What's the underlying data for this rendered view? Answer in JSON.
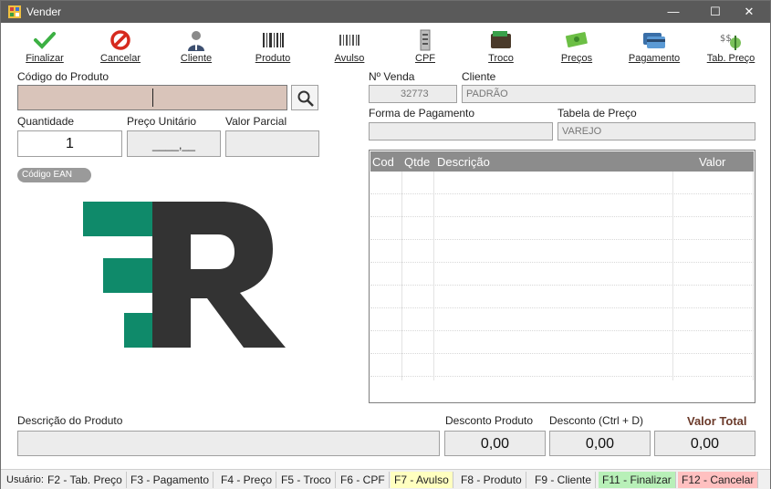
{
  "window": {
    "title": "Vender",
    "minimize": "—",
    "maximize": "☐",
    "close": "✕"
  },
  "toolbar": [
    {
      "label": "Finalizar",
      "icon": "check-icon"
    },
    {
      "label": "Cancelar",
      "icon": "cancel-icon"
    },
    {
      "label": "Cliente",
      "icon": "user-icon"
    },
    {
      "label": "Produto",
      "icon": "barcode-icon"
    },
    {
      "label": "Avulso",
      "icon": "barcode-alt-icon"
    },
    {
      "label": "CPF",
      "icon": "document-icon"
    },
    {
      "label": "Troco",
      "icon": "wallet-icon"
    },
    {
      "label": "Preços",
      "icon": "money-icon"
    },
    {
      "label": "Pagamento",
      "icon": "credit-card-icon"
    },
    {
      "label": "Tab. Preço",
      "icon": "price-table-icon"
    }
  ],
  "product": {
    "code_label": "Código do Produto",
    "code_value": "",
    "qty_label": "Quantidade",
    "qty_value": "1",
    "unit_price_label": "Preço Unitário",
    "unit_price_value": "____,__",
    "partial_label": "Valor Parcial",
    "partial_value": "",
    "ean_label": "Código EAN"
  },
  "sale": {
    "number_label": "Nº Venda",
    "number_value": "32773",
    "client_label": "Cliente",
    "client_value": "PADRÃO",
    "payment_label": "Forma de Pagamento",
    "payment_value": "",
    "price_table_label": "Tabela de Preço",
    "price_table_value": "VAREJO"
  },
  "grid": {
    "columns": [
      "Cod",
      "Qtde",
      "Descrição",
      "Valor"
    ]
  },
  "bottom": {
    "description_label": "Descrição do Produto",
    "description_value": "",
    "product_discount_label": "Desconto Produto",
    "product_discount_value": "0,00",
    "discount_label": "Desconto (Ctrl + D)",
    "discount_value": "0,00",
    "total_label": "Valor Total",
    "total_value": "0,00"
  },
  "statusbar": {
    "user_label": "Usuário:",
    "items": [
      {
        "label": "F2 - Tab. Preço"
      },
      {
        "label": "F3 - Pagamento"
      },
      {
        "label": "F4 - Preço"
      },
      {
        "label": "F5 - Troco"
      },
      {
        "label": "F6 - CPF"
      },
      {
        "label": "F7 - Avulso"
      },
      {
        "label": "F8 - Produto"
      },
      {
        "label": "F9 - Cliente"
      },
      {
        "label": "F11 - Finalizar"
      },
      {
        "label": "F12 - Cancelar"
      }
    ]
  },
  "colors": {
    "titlebar": "#5a5a5a",
    "logo_green": "#0f8a6a",
    "logo_dark": "#333333",
    "code_field": "#d9c4ba",
    "total_label": "#6b3a2a",
    "f7_bg": "#ffffc0",
    "f11_bg": "#b8f0b8",
    "f12_bg": "#ffc0c0"
  }
}
